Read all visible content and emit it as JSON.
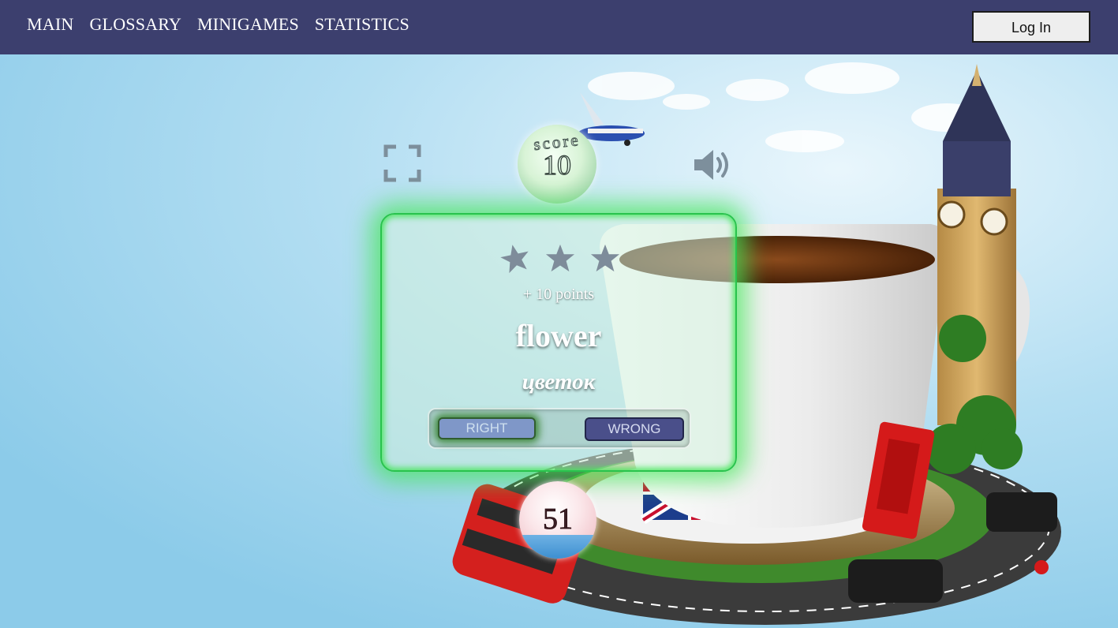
{
  "nav": {
    "items": [
      {
        "label": "MAIN"
      },
      {
        "label": "GLOSSARY"
      },
      {
        "label": "MINIGAMES"
      },
      {
        "label": "STATISTICS"
      }
    ],
    "login_label": "Log In"
  },
  "game": {
    "score_label": "score",
    "score_value": "10",
    "stars_count": 3,
    "points_text": "+ 10 points",
    "word": "flower",
    "translation": "цветок",
    "right_label": "RIGHT",
    "wrong_label": "WRONG",
    "timer_value": "51",
    "icons": [
      "fullscreen-icon",
      "speaker-icon",
      "star-icon"
    ]
  },
  "colors": {
    "navbar": "#3c3f6e",
    "card_glow": "#46e65a",
    "right_button": "#7f97c8",
    "wrong_button": "#4a4f8a",
    "sky": "#9fd3ec"
  }
}
